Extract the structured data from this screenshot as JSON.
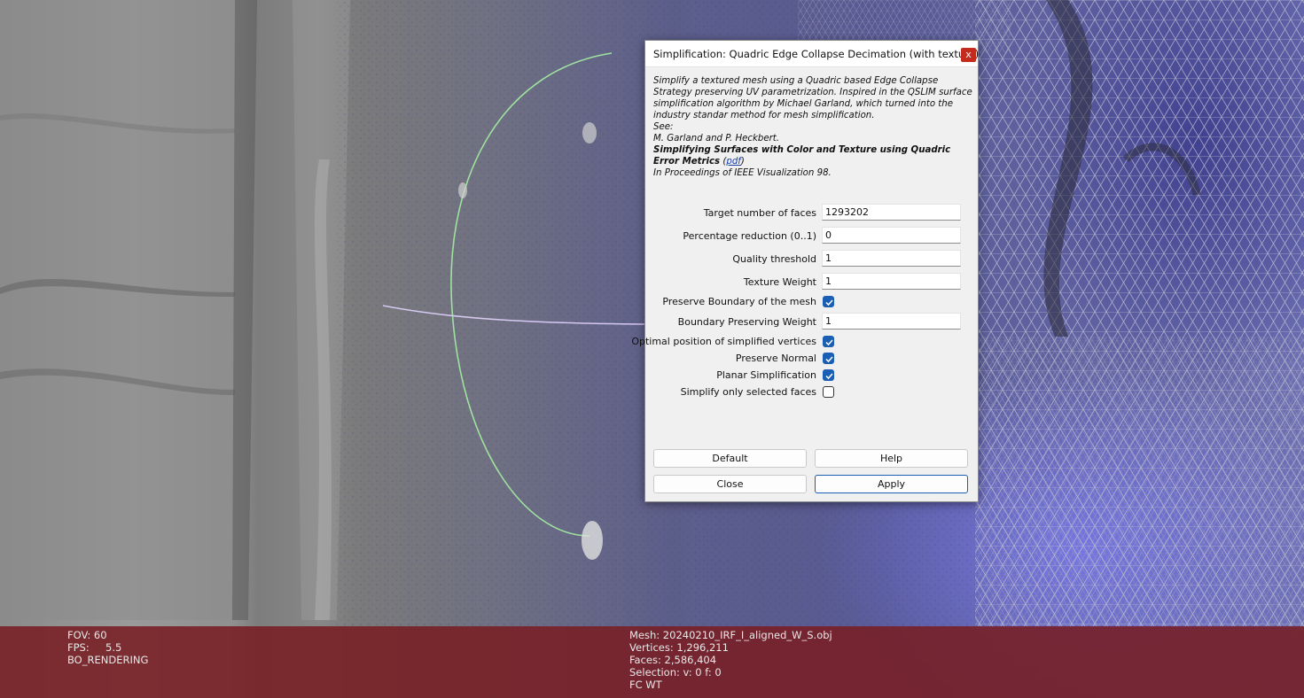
{
  "viewport": {
    "hud_left": [
      "FOV: 60",
      "FPS:     5.5",
      "BO_RENDERING"
    ],
    "hud_right": [
      "Mesh: 20240210_IRF_I_aligned_W_S.obj",
      "Vertices: 1,296,211",
      "Faces: 2,586,404",
      "Selection: v: 0 f: 0",
      "FC WT"
    ]
  },
  "dialog": {
    "title": "Simplification: Quadric Edge Collapse Decimation (with texture)",
    "close_label": "x",
    "description": {
      "intro": "Simplify a textured mesh using a Quadric based Edge Collapse Strategy preserving UV parametrization. Inspired in the QSLIM surface simplification algorithm by Michael Garland, which turned into the industry standar method for mesh simplification.",
      "see": "See:",
      "authors": "M. Garland and P. Heckbert.",
      "paper_title": "Simplifying Surfaces with Color and Texture using Quadric Error Metrics",
      "link_open": "(",
      "link_text": "pdf",
      "link_close": ")",
      "proceedings": "In Proceedings of IEEE Visualization 98."
    },
    "params": {
      "target_faces": {
        "label": "Target number of faces",
        "value": "1293202"
      },
      "percentage": {
        "label": "Percentage reduction (0..1)",
        "value": "0"
      },
      "quality": {
        "label": "Quality threshold",
        "value": "1"
      },
      "texture_weight": {
        "label": "Texture Weight",
        "value": "1"
      },
      "preserve_boundary": {
        "label": "Preserve Boundary of the mesh",
        "checked": true
      },
      "boundary_weight": {
        "label": "Boundary Preserving Weight",
        "value": "1"
      },
      "optimal_position": {
        "label": "Optimal position of simplified vertices",
        "checked": true
      },
      "preserve_normal": {
        "label": "Preserve Normal",
        "checked": true
      },
      "planar": {
        "label": "Planar Simplification",
        "checked": true
      },
      "selected_only": {
        "label": "Simplify only selected faces",
        "checked": false
      }
    },
    "buttons": {
      "default": "Default",
      "help": "Help",
      "close": "Close",
      "apply": "Apply"
    }
  }
}
